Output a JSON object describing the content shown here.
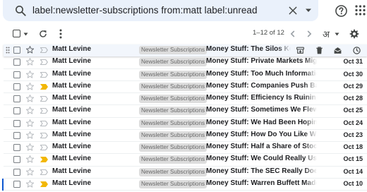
{
  "search": {
    "query": "label:newsletter-subscriptions from:matt label:unread",
    "icons": {
      "search": "search-icon",
      "clear": "close-icon",
      "options": "tune-dropdown-icon"
    }
  },
  "header": {
    "help_icon": "help-icon",
    "apps_icon": "apps-grid-icon"
  },
  "toolbar": {
    "pagination": "1–12 of 12",
    "input_tool": "अ",
    "icons": [
      "select-all-checkbox",
      "refresh-icon",
      "more-vert-icon",
      "chevron-left-icon",
      "chevron-right-icon",
      "gear-icon"
    ]
  },
  "colors": {
    "accent": "#0b57d0",
    "important_marker": "#f2b705",
    "label_chip_bg": "#dddddd",
    "hover_row_bg": "#f2f6fc"
  },
  "emails": [
    {
      "sender": "Matt Levine",
      "label": "Newsletter Subscriptions",
      "subject": "Money Stuff: The Silos Keep Multiplying",
      "date": "",
      "important": false,
      "starred": false,
      "hovered": true
    },
    {
      "sender": "Matt Levine",
      "label": "Newsletter Subscriptions",
      "subject": "Money Stuff: Private Markets Might Be Everywhere",
      "date": "Oct 31",
      "important": false,
      "starred": false,
      "hovered": false
    },
    {
      "sender": "Matt Levine",
      "label": "Newsletter Subscriptions",
      "subject": "Money Stuff: Too Much Information Can Hurt",
      "date": "Oct 30",
      "important": false,
      "starred": false,
      "hovered": false
    },
    {
      "sender": "Matt Levine",
      "label": "Newsletter Subscriptions",
      "subject": "Money Stuff: Companies Push Back on Activists",
      "date": "Oct 29",
      "important": true,
      "starred": false,
      "hovered": false
    },
    {
      "sender": "Matt Levine",
      "label": "Newsletter Subscriptions",
      "subject": "Money Stuff: Efficiency Is Ruining Hedge Funds",
      "date": "Oct 28",
      "important": false,
      "starred": false,
      "hovered": false
    },
    {
      "sender": "Matt Levine",
      "label": "Newsletter Subscriptions",
      "subject": "Money Stuff: Sometimes We Flew to the Moon",
      "date": "Oct 25",
      "important": false,
      "starred": false,
      "hovered": false
    },
    {
      "sender": "Matt Levine",
      "label": "Newsletter Subscriptions",
      "subject": "Money Stuff: We Had Been Hoping to Avoid This",
      "date": "Oct 24",
      "important": false,
      "starred": false,
      "hovered": false
    },
    {
      "sender": "Matt Levine",
      "label": "Newsletter Subscriptions",
      "subject": "Money Stuff: How Do You Like We Now",
      "date": "Oct 23",
      "important": false,
      "starred": false,
      "hovered": false
    },
    {
      "sender": "Matt Levine",
      "label": "Newsletter Subscriptions",
      "subject": "Money Stuff: Half a Share of Stock Is Plenty",
      "date": "Oct 18",
      "important": false,
      "starred": false,
      "hovered": false
    },
    {
      "sender": "Matt Levine",
      "label": "Newsletter Subscriptions",
      "subject": "Money Stuff: We Could Really Use Some Volatility",
      "date": "Oct 15",
      "important": true,
      "starred": false,
      "hovered": false
    },
    {
      "sender": "Matt Levine",
      "label": "Newsletter Subscriptions",
      "subject": "Money Stuff: The SEC Really Doesn't Like Crypto",
      "date": "Oct 14",
      "important": false,
      "starred": false,
      "hovered": false
    },
    {
      "sender": "Matt Levine",
      "label": "Newsletter Subscriptions",
      "subject": "Money Stuff: Warren Buffett Made a Bet",
      "date": "Oct 10",
      "important": true,
      "starred": false,
      "hovered": false
    }
  ]
}
